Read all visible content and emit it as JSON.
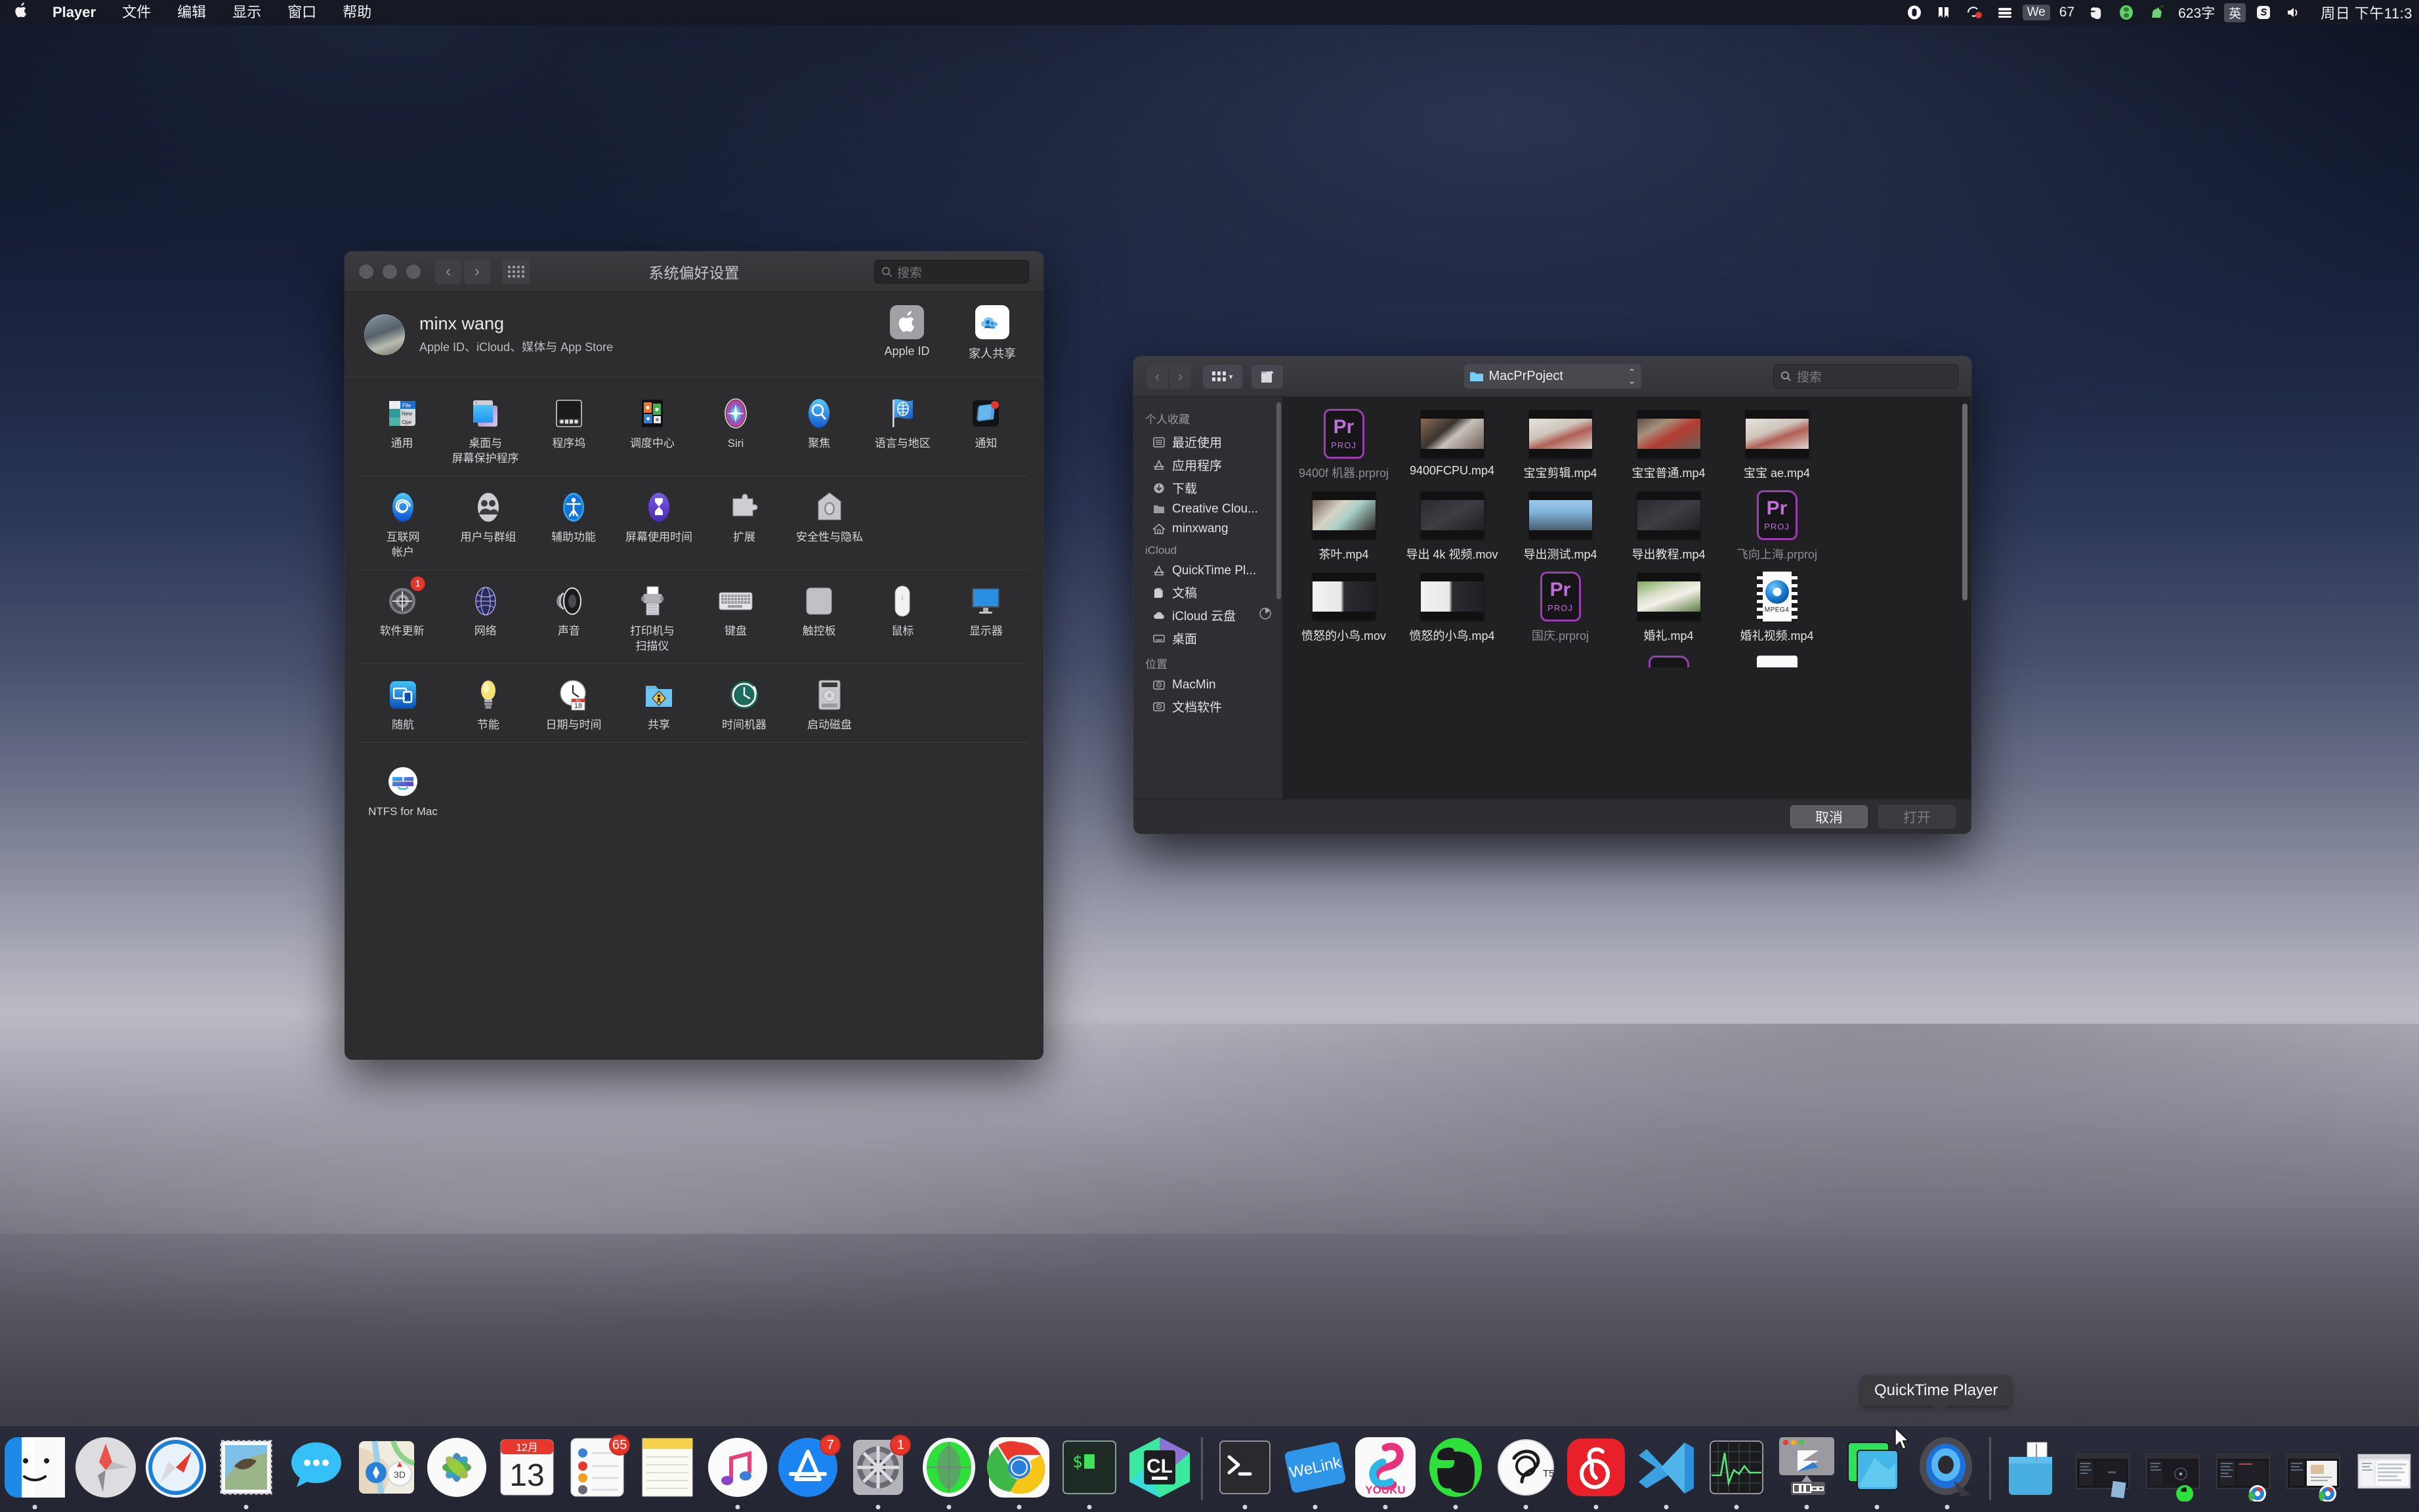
{
  "menubar": {
    "app_name": "Player",
    "items": [
      "文件",
      "编辑",
      "显示",
      "窗口",
      "帮助"
    ],
    "status_icons": [
      "onedrive-icon",
      "kindle-icon",
      "clashx-icon",
      "istat-icon"
    ],
    "wechat_label": "We",
    "battery_percent": "67",
    "evernote_icon": "evernote-icon",
    "snipaste_icon": "snipaste-icon",
    "trojan_icon": "trojan-horse-icon",
    "word_count": "623字",
    "input_source": "英",
    "sogou_icon": "sogou-icon",
    "volume_icon": "volume-icon",
    "clock": "周日 下午11:3"
  },
  "sysprefs": {
    "title": "系统偏好设置",
    "search_placeholder": "搜索",
    "account": {
      "name": "minx wang",
      "subtitle": "Apple ID、iCloud、媒体与 App Store",
      "tiles": [
        {
          "label": "Apple ID",
          "icon": "apple-logo-icon"
        },
        {
          "label": "家人共享",
          "icon": "family-sharing-icon"
        }
      ]
    },
    "rows": [
      [
        {
          "label": "通用",
          "icon": "general-icon"
        },
        {
          "label": "桌面与\n屏幕保护程序",
          "icon": "desktop-screensaver-icon"
        },
        {
          "label": "程序坞",
          "icon": "dock-icon"
        },
        {
          "label": "调度中心",
          "icon": "mission-control-icon"
        },
        {
          "label": "Siri",
          "icon": "siri-icon"
        },
        {
          "label": "聚焦",
          "icon": "spotlight-icon"
        },
        {
          "label": "语言与地区",
          "icon": "language-region-icon"
        },
        {
          "label": "通知",
          "icon": "notifications-icon"
        }
      ],
      [
        {
          "label": "互联网\n帐户",
          "icon": "internet-accounts-icon"
        },
        {
          "label": "用户与群组",
          "icon": "users-groups-icon"
        },
        {
          "label": "辅助功能",
          "icon": "accessibility-icon"
        },
        {
          "label": "屏幕使用时间",
          "icon": "screen-time-icon"
        },
        {
          "label": "扩展",
          "icon": "extensions-icon"
        },
        {
          "label": "安全性与隐私",
          "icon": "security-privacy-icon"
        }
      ],
      [
        {
          "label": "软件更新",
          "icon": "software-update-icon",
          "badge": "1"
        },
        {
          "label": "网络",
          "icon": "network-icon"
        },
        {
          "label": "声音",
          "icon": "sound-icon"
        },
        {
          "label": "打印机与\n扫描仪",
          "icon": "printers-scanners-icon"
        },
        {
          "label": "键盘",
          "icon": "keyboard-icon"
        },
        {
          "label": "触控板",
          "icon": "trackpad-icon"
        },
        {
          "label": "鼠标",
          "icon": "mouse-icon"
        },
        {
          "label": "显示器",
          "icon": "displays-icon"
        }
      ],
      [
        {
          "label": "随航",
          "icon": "sidecar-icon"
        },
        {
          "label": "节能",
          "icon": "energy-saver-icon"
        },
        {
          "label": "日期与时间",
          "icon": "date-time-icon"
        },
        {
          "label": "共享",
          "icon": "sharing-icon"
        },
        {
          "label": "时间机器",
          "icon": "time-machine-icon"
        },
        {
          "label": "启动磁盘",
          "icon": "startup-disk-icon"
        }
      ]
    ],
    "third_party": [
      {
        "label": "NTFS for Mac",
        "icon": "ntfs-for-mac-icon"
      }
    ]
  },
  "filedialog": {
    "path_label": "MacPrPoject",
    "search_placeholder": "搜索",
    "sidebar": [
      {
        "header": "个人收藏",
        "items": [
          {
            "label": "最近使用",
            "icon": "recents-icon"
          },
          {
            "label": "应用程序",
            "icon": "applications-icon"
          },
          {
            "label": "下载",
            "icon": "downloads-icon"
          },
          {
            "label": "Creative Clou...",
            "icon": "folder-icon"
          },
          {
            "label": "minxwang",
            "icon": "home-icon"
          }
        ]
      },
      {
        "header": "iCloud",
        "items": [
          {
            "label": "QuickTime Pl...",
            "icon": "applications-icon"
          },
          {
            "label": "文稿",
            "icon": "documents-icon"
          },
          {
            "label": "iCloud 云盘",
            "icon": "icloud-drive-icon",
            "extra": "sync-progress-icon"
          },
          {
            "label": "桌面",
            "icon": "desktop-folder-icon"
          }
        ]
      },
      {
        "header": "位置",
        "items": [
          {
            "label": "MacMin",
            "icon": "hard-disk-icon"
          },
          {
            "label": "文档软件",
            "icon": "hard-disk-icon"
          }
        ]
      }
    ],
    "files": [
      [
        {
          "name": "9400f 机器.prproj",
          "kind": "prproj",
          "dim": true
        },
        {
          "name": "9400FCPU.mp4",
          "kind": "video",
          "thumb": "c1"
        },
        {
          "name": "宝宝剪辑.mp4",
          "kind": "video",
          "thumb": "c2"
        },
        {
          "name": "宝宝普通.mp4",
          "kind": "video",
          "thumb": "c3"
        },
        {
          "name": "宝宝 ae.mp4",
          "kind": "video",
          "thumb": "c2"
        }
      ],
      [
        {
          "name": "茶叶.mp4",
          "kind": "video",
          "thumb": "c4"
        },
        {
          "name": "导出 4k 视频.mov",
          "kind": "video",
          "thumb": "c5"
        },
        {
          "name": "导出测试.mp4",
          "kind": "video",
          "thumb": "c6"
        },
        {
          "name": "导出教程.mp4",
          "kind": "video",
          "thumb": "c5"
        },
        {
          "name": "飞向上海.prproj",
          "kind": "prproj",
          "dim": true
        }
      ],
      [
        {
          "name": "愤怒的小鸟.mov",
          "kind": "video",
          "thumb": "c7"
        },
        {
          "name": "愤怒的小鸟.mp4",
          "kind": "video",
          "thumb": "c7"
        },
        {
          "name": "国庆.prproj",
          "kind": "prproj",
          "dim": true
        },
        {
          "name": "婚礼.mp4",
          "kind": "video",
          "thumb": "c8"
        },
        {
          "name": "婚礼视频.mp4",
          "kind": "quicktime"
        }
      ]
    ],
    "cancel_label": "取消",
    "open_label": "打开"
  },
  "dock": {
    "tooltip": "QuickTime Player",
    "items": [
      {
        "name": "finder-icon",
        "label": "Finder",
        "running": true
      },
      {
        "name": "launchpad-icon",
        "label": "Launchpad",
        "running": false
      },
      {
        "name": "safari-icon",
        "label": "Safari",
        "running": false
      },
      {
        "name": "mail-icon",
        "label": "邮件",
        "running": true
      },
      {
        "name": "messages-icon",
        "label": "信息",
        "running": false
      },
      {
        "name": "maps-icon",
        "label": "地图",
        "running": false
      },
      {
        "name": "photos-icon",
        "label": "照片",
        "running": false
      },
      {
        "name": "calendar-icon",
        "label": "日历",
        "running": false,
        "month": "12月",
        "day": "13"
      },
      {
        "name": "reminders-icon",
        "label": "提醒事项",
        "running": false,
        "badge": "65"
      },
      {
        "name": "notes-icon",
        "label": "备忘录",
        "running": false
      },
      {
        "name": "music-icon",
        "label": "音乐",
        "running": true
      },
      {
        "name": "appstore-icon",
        "label": "App Store",
        "running": false,
        "badge": "7"
      },
      {
        "name": "system-preferences-icon",
        "label": "系统偏好设置",
        "running": true,
        "badge": "1"
      },
      {
        "name": "xmind-icon",
        "label": "XMind",
        "running": true
      },
      {
        "name": "chrome-icon",
        "label": "Google Chrome",
        "running": true
      },
      {
        "name": "iterm-icon",
        "label": "iTerm",
        "running": true
      },
      {
        "name": "clion-icon",
        "label": "CLion",
        "running": false
      },
      {
        "name": "separator",
        "label": "",
        "running": false
      },
      {
        "name": "terminal-icon",
        "label": "终端",
        "running": true
      },
      {
        "name": "welink-icon",
        "label": "WeLink",
        "running": true
      },
      {
        "name": "youku-icon",
        "label": "优酷",
        "running": true
      },
      {
        "name": "evernote-icon",
        "label": "印象笔记",
        "running": true
      },
      {
        "name": "t5-icon",
        "label": "T5",
        "running": true
      },
      {
        "name": "netease-music-icon",
        "label": "网易云音乐",
        "running": true
      },
      {
        "name": "vscode-icon",
        "label": "Visual Studio Code",
        "running": true
      },
      {
        "name": "activity-monitor-icon",
        "label": "活动监视器",
        "running": true
      },
      {
        "name": "snagit-icon",
        "label": "Snagit",
        "running": true
      },
      {
        "name": "preview-icon",
        "label": "预览",
        "running": true
      },
      {
        "name": "quicktime-player-icon",
        "label": "QuickTime Player",
        "running": true
      },
      {
        "name": "separator",
        "label": "",
        "running": false
      },
      {
        "name": "downloads-stack-icon",
        "label": "下载",
        "running": false
      },
      {
        "name": "minimized-window-1",
        "label": "最小化窗口",
        "running": false
      },
      {
        "name": "minimized-window-2",
        "label": "最小化窗口",
        "running": false
      },
      {
        "name": "minimized-window-3",
        "label": "最小化窗口",
        "running": false
      },
      {
        "name": "minimized-window-4",
        "label": "最小化窗口",
        "running": false
      },
      {
        "name": "minimized-window-5",
        "label": "最小化窗口",
        "running": false
      }
    ]
  }
}
